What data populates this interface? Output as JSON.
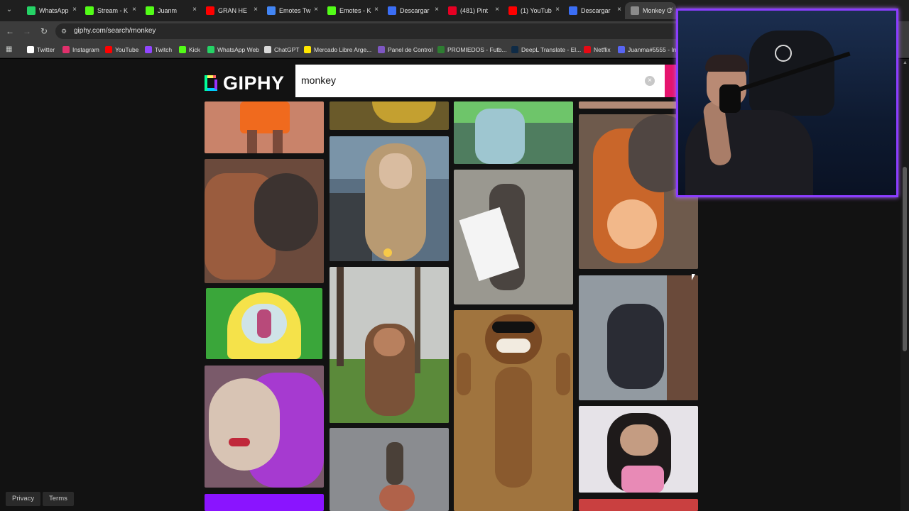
{
  "browser": {
    "tabs": [
      {
        "label": "WhatsApp",
        "color": "#25d366"
      },
      {
        "label": "Stream - K",
        "color": "#53fc18"
      },
      {
        "label": "Juanm",
        "color": "#53fc18"
      },
      {
        "label": "GRAN HE",
        "color": "#ff0000"
      },
      {
        "label": "Emotes Tw",
        "color": "#4285f4"
      },
      {
        "label": "Emotes - K",
        "color": "#53fc18"
      },
      {
        "label": "Descargar",
        "color": "#3b6ef5"
      },
      {
        "label": "(481) Pint",
        "color": "#e60023"
      },
      {
        "label": "(1) YouTub",
        "color": "#ff0000"
      },
      {
        "label": "Descargar",
        "color": "#3b6ef5"
      },
      {
        "label": "Monkey G",
        "color": "#8b8b8b",
        "active": true
      }
    ],
    "url": "giphy.com/search/monkey",
    "bookmarks": [
      {
        "label": "Twitter",
        "color": "#ffffff"
      },
      {
        "label": "Instagram",
        "color": "#e1306c"
      },
      {
        "label": "YouTube",
        "color": "#ff0000"
      },
      {
        "label": "Twitch",
        "color": "#9146ff"
      },
      {
        "label": "Kick",
        "color": "#53fc18"
      },
      {
        "label": "WhatsApp Web",
        "color": "#25d366"
      },
      {
        "label": "ChatGPT",
        "color": "#d9d9d9"
      },
      {
        "label": "Mercado Libre Arge...",
        "color": "#ffe600"
      },
      {
        "label": "Panel de Control",
        "color": "#7e57c2"
      },
      {
        "label": "PROMIEDOS - Futb...",
        "color": "#2e7d32"
      },
      {
        "label": "DeepL Translate - El...",
        "color": "#0f2b46"
      },
      {
        "label": "Netflix",
        "color": "#e50914"
      },
      {
        "label": "Juanma#5555 - Infi",
        "color": "#5865f2"
      }
    ]
  },
  "giphy": {
    "logo_text": "GIPHY",
    "search_value": "monkey",
    "footer": {
      "privacy": "Privacy",
      "terms": "Terms"
    },
    "accent": "#e6146e"
  }
}
